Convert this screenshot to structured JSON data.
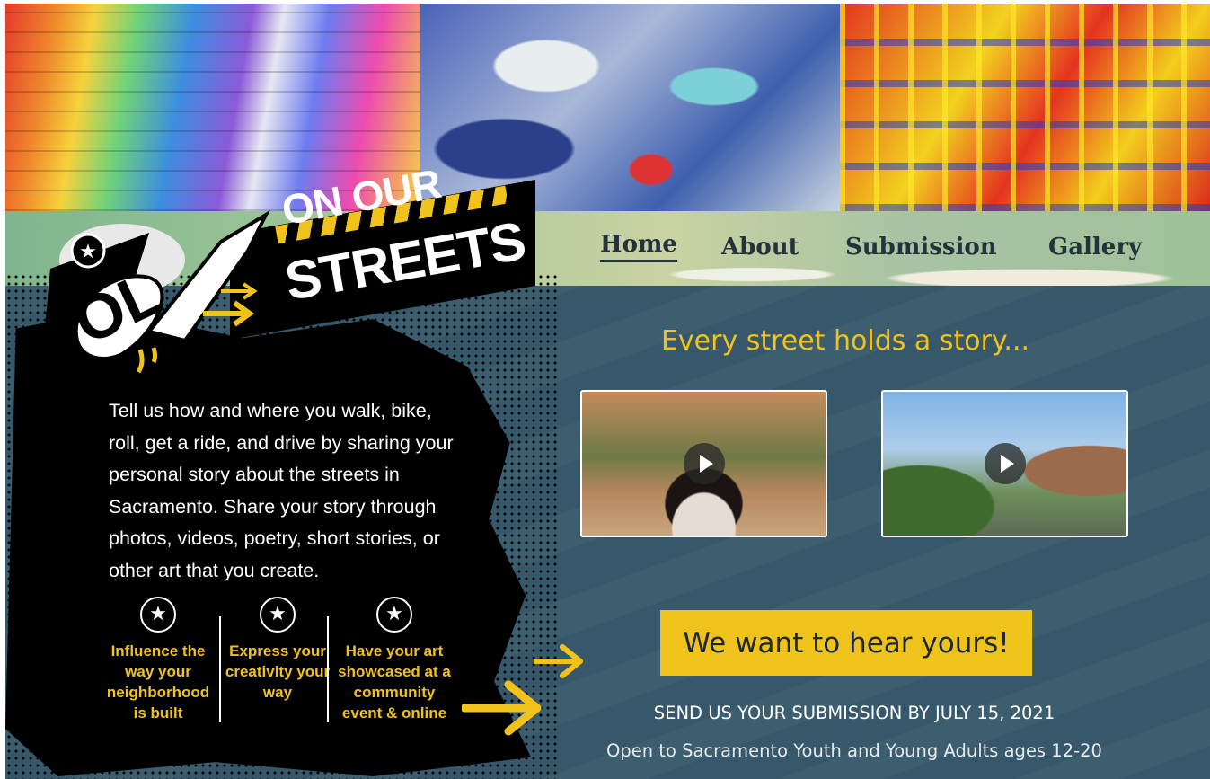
{
  "nav": {
    "items": [
      {
        "label": "Home",
        "active": true
      },
      {
        "label": "About",
        "active": false
      },
      {
        "label": "Submission",
        "active": false
      },
      {
        "label": "Gallery",
        "active": false
      }
    ]
  },
  "logo": {
    "line1": "ON OUR",
    "line2": "STREETS",
    "mark": "OL",
    "colors": {
      "accent": "#f0c21c",
      "bg": "#000000"
    }
  },
  "intro": "Tell us how and where you walk, bike, roll, get a ride, and drive by sharing your personal story about the streets in Sacramento. Share your story through photos, videos, poetry, short stories, or other art that you create.",
  "features": [
    {
      "icon": "star-icon",
      "text": "Influence the way your neighborhood is built"
    },
    {
      "icon": "star-icon",
      "text": "Express your creativity your way"
    },
    {
      "icon": "star-icon",
      "text": "Have your art showcased at a community event & online"
    }
  ],
  "tagline": "Every street holds a story...",
  "videos": [
    {
      "icon": "play-icon"
    },
    {
      "icon": "play-icon"
    }
  ],
  "cta": {
    "label": "We want to hear yours!"
  },
  "deadline": "SEND US YOUR SUBMISSION BY JULY 15, 2021",
  "eligibility": "Open to Sacramento Youth and Young Adults ages 12-20",
  "colors": {
    "accent": "#f0c21c",
    "background": "#36586a",
    "text": "#ffffff"
  }
}
